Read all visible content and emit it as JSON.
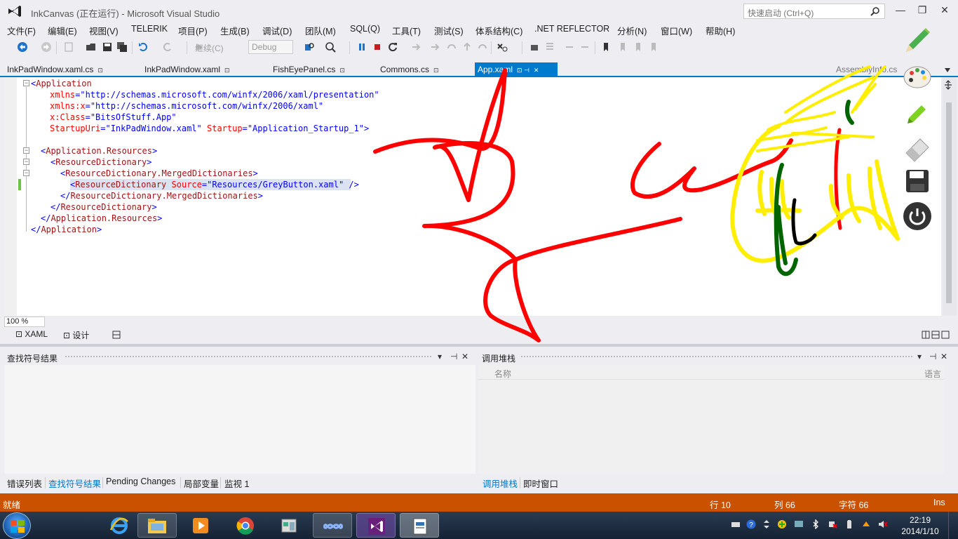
{
  "window": {
    "title": "InkCanvas (正在运行) - Microsoft Visual Studio",
    "quick_launch_placeholder": "快速启动 (Ctrl+Q)",
    "min": "—",
    "max": "❐",
    "close": "✕"
  },
  "menu": [
    "文件(F)",
    "编辑(E)",
    "视图(V)",
    "TELERIK",
    "项目(P)",
    "生成(B)",
    "调试(D)",
    "团队(M)",
    "SQL(Q)",
    "工具(T)",
    "测试(S)",
    "体系结构(C)",
    ".NET REFLECTOR",
    "分析(N)",
    "窗口(W)",
    "帮助(H)"
  ],
  "toolbar": {
    "continue_label": "继续(C)",
    "config_value": "Debug"
  },
  "tabs": [
    {
      "label": "InkPadWindow.xaml.cs",
      "pin": "⊡"
    },
    {
      "label": "InkPadWindow.xaml",
      "pin": "⊡"
    },
    {
      "label": "FishEyePanel.cs",
      "pin": "⊡"
    },
    {
      "label": "Commons.cs",
      "pin": "⊡"
    },
    {
      "label": "App.xaml",
      "pin": "⊡ ⊣",
      "close": "✕"
    },
    {
      "label": "AssemblyInfo.cs",
      "close": "✕"
    }
  ],
  "code": {
    "l1": {
      "a": "<",
      "b": "Application"
    },
    "l2": {
      "attr": "xmlns",
      "eq": "=",
      "val": "\"http://schemas.microsoft.com/winfx/2006/xaml/presentation\""
    },
    "l3": {
      "attr": "xmlns:x",
      "eq": "=",
      "val": "\"http://schemas.microsoft.com/winfx/2006/xaml\""
    },
    "l4": {
      "attr": "x:Class",
      "eq": "=",
      "val": "\"BitsOfStuff.App\""
    },
    "l5": {
      "attr": "StartupUri",
      "eq": "=",
      "val": "\"InkPadWindow.xaml\"",
      "attr2": "Startup",
      "eq2": "=",
      "val2": "\"Application_Startup_1\"",
      "end": ">"
    },
    "l7": {
      "a": "<",
      "b": "Application.Resources",
      "c": ">"
    },
    "l8": {
      "a": "<",
      "b": "ResourceDictionary",
      "c": ">"
    },
    "l9": {
      "a": "<",
      "b": "ResourceDictionary.MergedDictionaries",
      "c": ">"
    },
    "l10": {
      "a": "<",
      "b": "ResourceDictionary",
      "attr": "Source",
      "eq": "=",
      "val": "\"Resources/GreyButton.xaml\"",
      "c": " />"
    },
    "l11": {
      "a": "</",
      "b": "ResourceDictionary.MergedDictionaries",
      "c": ">"
    },
    "l12": {
      "a": "</",
      "b": "ResourceDictionary",
      "c": ">"
    },
    "l13": {
      "a": "</",
      "b": "Application.Resources",
      "c": ">"
    },
    "l14": {
      "a": "</",
      "b": "Application",
      "c": ">"
    }
  },
  "zoom": "100 %",
  "view_tabs": {
    "xaml": "XAML",
    "design": "设计"
  },
  "left_panel": {
    "title": "查找符号结果"
  },
  "right_panel": {
    "title": "调用堆栈",
    "col_name": "名称",
    "col_lang": "语言"
  },
  "bottom_tabs_left": [
    "错误列表",
    "查找符号结果",
    "Pending Changes",
    "局部变量",
    "监视 1"
  ],
  "bottom_tabs_right": [
    "调用堆栈",
    "即时窗口"
  ],
  "status": {
    "ready": "就绪",
    "line": "行 10",
    "col": "列 66",
    "char": "字符 66",
    "mode": "Ins"
  },
  "clock": {
    "time": "22:19",
    "date": "2014/1/10"
  },
  "colors": {
    "accent": "#007acc",
    "status_bar": "#ca5100",
    "ink_red": "#ff0000",
    "ink_yellow": "#ffee00",
    "ink_green": "#006400",
    "ink_black": "#000000"
  }
}
